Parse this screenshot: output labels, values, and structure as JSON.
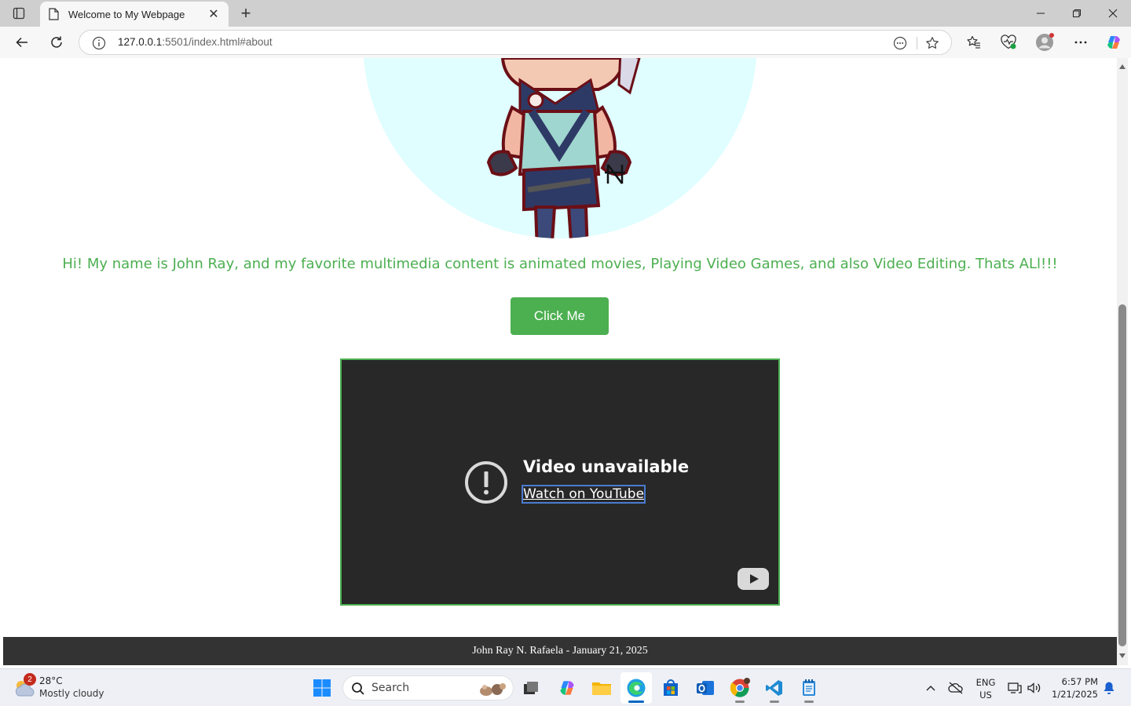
{
  "browser": {
    "tab": {
      "title": "Welcome to My Webpage",
      "close_glyph": "✕"
    },
    "new_tab_glyph": "+",
    "address": {
      "host": "127.0.0.1",
      "rest": ":5501/index.html#about"
    }
  },
  "page": {
    "intro_text": "Hi! My name is John Ray, and my favorite multimedia content is animated movies, Playing Video Games, and also Video Editing. Thats ALl!!!",
    "button_label": "Click Me",
    "video": {
      "title": "Video unavailable",
      "link": "Watch on YouTube"
    },
    "footer_text": "John Ray N. Rafaela - January 21, 2025"
  },
  "taskbar": {
    "weather": {
      "badge": "2",
      "temp": "28°C",
      "condition": "Mostly cloudy"
    },
    "search_placeholder": "Search",
    "lang_line1": "ENG",
    "lang_line2": "US",
    "time": "6:57 PM",
    "date": "1/21/2025"
  },
  "colors": {
    "accent_green": "#4caf50",
    "avatar_bg": "#e0feff",
    "footer_bg": "#333333",
    "video_bg": "#282828"
  }
}
